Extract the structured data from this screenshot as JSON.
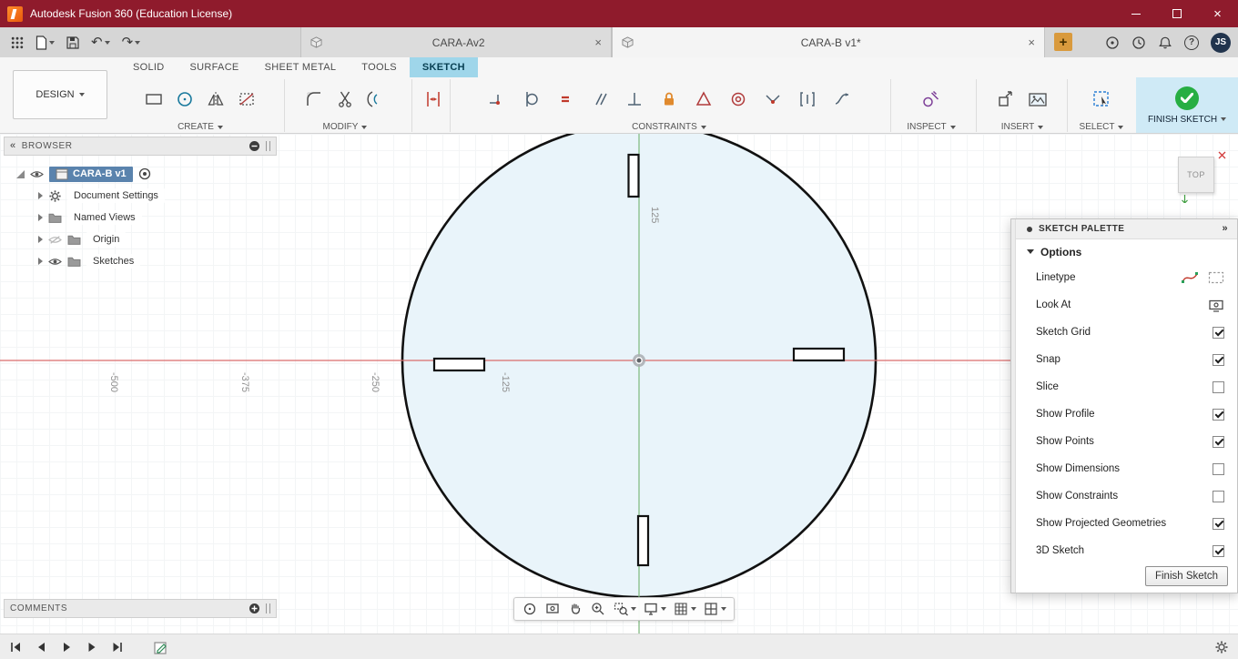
{
  "colors": {
    "titlebar": "#8f1b2c",
    "accent_blue": "#9fd6ea",
    "finish_bg": "#cfeaf6",
    "accent_green": "#27ae43",
    "axis_red": "#d96c6c",
    "axis_green": "#7cb87c",
    "selection_blue": "#5a83ad",
    "profile_fill": "#e9f4fa",
    "new_tab_orange": "#d99a3d"
  },
  "icons": {
    "close": "×",
    "plus": "+",
    "undo": "↶",
    "redo": "↷",
    "collapse_left": "«",
    "expand_right": "»",
    "help": "?"
  },
  "title_bar": {
    "title": "Autodesk Fusion 360 (Education License)"
  },
  "tab_bar": {
    "documents": [
      {
        "label": "CARA-Av2",
        "active": false
      },
      {
        "label": "CARA-B v1*",
        "active": true
      }
    ],
    "avatar_initials": "JS"
  },
  "ribbon": {
    "design_menu": "DESIGN",
    "tabs": [
      {
        "label": "SOLID",
        "active": false
      },
      {
        "label": "SURFACE",
        "active": false
      },
      {
        "label": "SHEET METAL",
        "active": false
      },
      {
        "label": "TOOLS",
        "active": false
      },
      {
        "label": "SKETCH",
        "active": true
      }
    ],
    "groups": {
      "create": "CREATE",
      "modify": "MODIFY",
      "constraints": "CONSTRAINTS",
      "inspect": "INSPECT",
      "insert": "INSERT",
      "select": "SELECT",
      "finish": "FINISH SKETCH"
    }
  },
  "browser": {
    "header": "BROWSER",
    "root_label": "CARA-B v1",
    "items": [
      "Document Settings",
      "Named Views",
      "Origin",
      "Sketches"
    ]
  },
  "comments": {
    "header": "COMMENTS"
  },
  "viewcube": {
    "face_label": "TOP"
  },
  "canvas": {
    "x_ticks": [
      "-500",
      "-375",
      "-250",
      "-125"
    ],
    "y_ticks": [
      "125"
    ]
  },
  "sketch_palette": {
    "header": "SKETCH PALETTE",
    "section": "Options",
    "rows": [
      {
        "label": "Linetype",
        "control": "linetype-icons"
      },
      {
        "label": "Look At",
        "control": "icon-button"
      },
      {
        "label": "Sketch Grid",
        "control": "checkbox",
        "checked": true
      },
      {
        "label": "Snap",
        "control": "checkbox",
        "checked": true
      },
      {
        "label": "Slice",
        "control": "checkbox",
        "checked": false
      },
      {
        "label": "Show Profile",
        "control": "checkbox",
        "checked": true
      },
      {
        "label": "Show Points",
        "control": "checkbox",
        "checked": true
      },
      {
        "label": "Show Dimensions",
        "control": "checkbox",
        "checked": false
      },
      {
        "label": "Show Constraints",
        "control": "checkbox",
        "checked": false
      },
      {
        "label": "Show Projected Geometries",
        "control": "checkbox",
        "checked": true
      },
      {
        "label": "3D Sketch",
        "control": "checkbox",
        "checked": true
      }
    ],
    "finish_button": "Finish Sketch"
  }
}
